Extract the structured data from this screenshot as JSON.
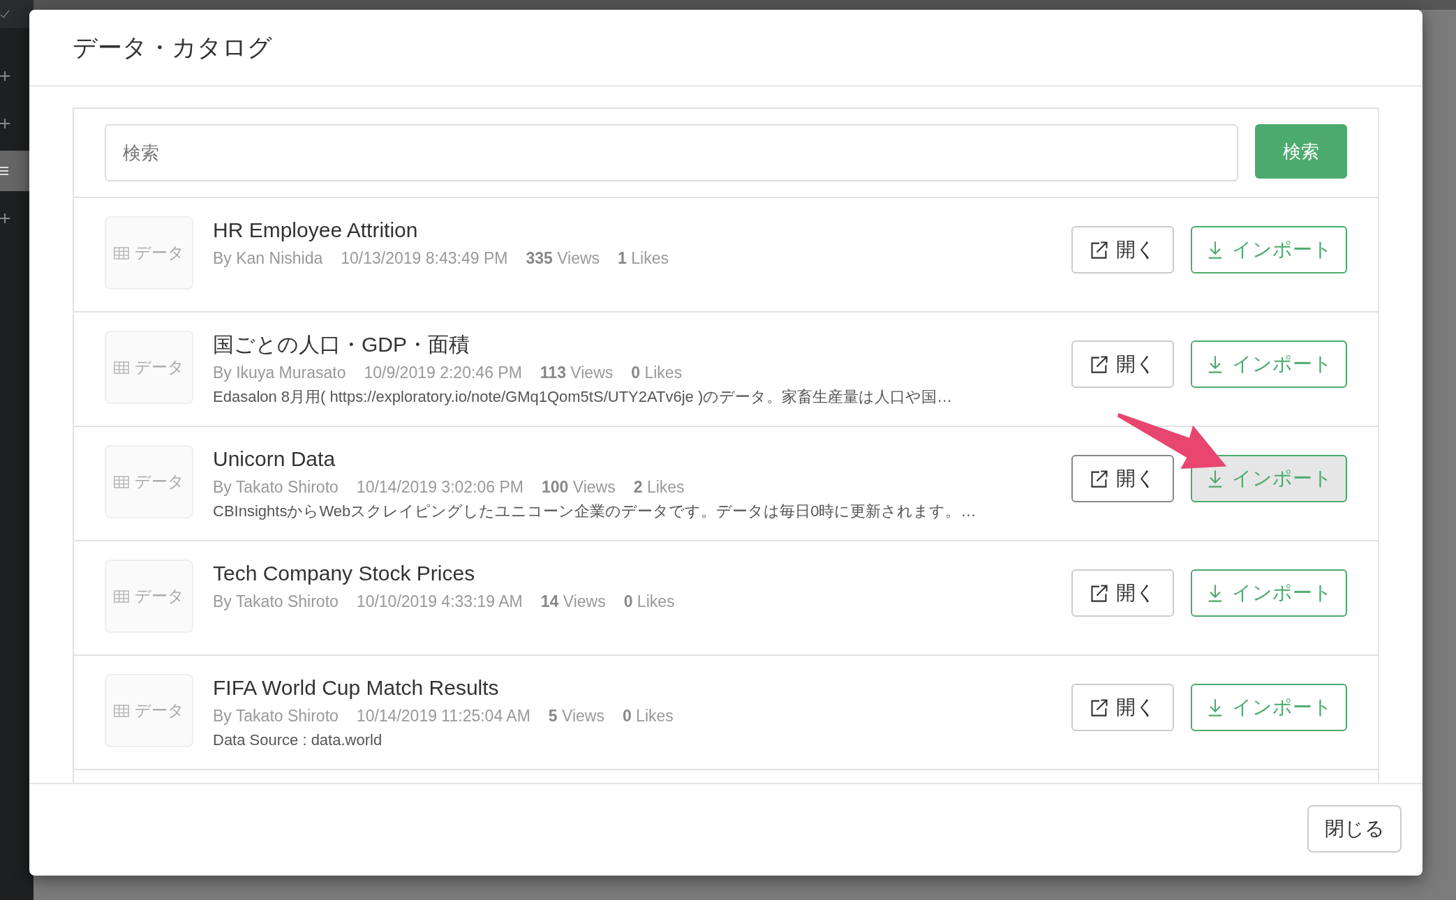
{
  "sidebar": {
    "items": [
      {
        "kind": "check",
        "selected": false
      },
      {
        "kind": "plus",
        "selected": false
      },
      {
        "kind": "plus",
        "selected": false
      },
      {
        "kind": "menu",
        "selected": true
      },
      {
        "kind": "plus",
        "selected": false
      }
    ]
  },
  "dialog": {
    "title": "データ・カタログ",
    "search": {
      "placeholder": "検索",
      "button": "検索"
    },
    "items": [
      {
        "thumb": "データ",
        "title": "HR Employee Attrition",
        "author": "By Kan Nishida",
        "date": "10/13/2019 8:43:49 PM",
        "views": "**335** Views",
        "likes": "**1** Likes",
        "open": "開く",
        "import": "インポート",
        "hovered": false
      },
      {
        "thumb": "データ",
        "title": "国ごとの人口・GDP・面積",
        "author": "By Ikuya Murasato",
        "date": "10/9/2019 2:20:46 PM",
        "views": "**113** Views",
        "likes": "**0** Likes",
        "description": "Edasalon 8月用( https://exploratory.io/note/GMq1Qom5tS/UTY2ATv6je )のデータ。家畜生産量は人口や国…",
        "open": "開く",
        "import": "インポート",
        "hovered": false
      },
      {
        "thumb": "データ",
        "title": "Unicorn Data",
        "author": "By Takato Shiroto",
        "date": "10/14/2019 3:02:06 PM",
        "views": "**100** Views",
        "likes": "**2** Likes",
        "description": "CBInsightsからWebスクレイピングしたユニコーン企業のデータです。データは毎日0時に更新されます。…",
        "open": "開く",
        "import": "インポート",
        "hovered": true
      },
      {
        "thumb": "データ",
        "title": "Tech Company Stock Prices",
        "author": "By Takato Shiroto",
        "date": "10/10/2019 4:33:19 AM",
        "views": "**14** Views",
        "likes": "**0** Likes",
        "open": "開く",
        "import": "インポート",
        "hovered": false
      },
      {
        "thumb": "データ",
        "title": "FIFA World Cup Match Results",
        "author": "By Takato Shiroto",
        "date": "10/14/2019 11:25:04 AM",
        "views": "**5** Views",
        "likes": "**0** Likes",
        "description": "Data Source : data.world",
        "open": "開く",
        "import": "インポート",
        "hovered": false
      }
    ],
    "close_button": "閉じる"
  }
}
